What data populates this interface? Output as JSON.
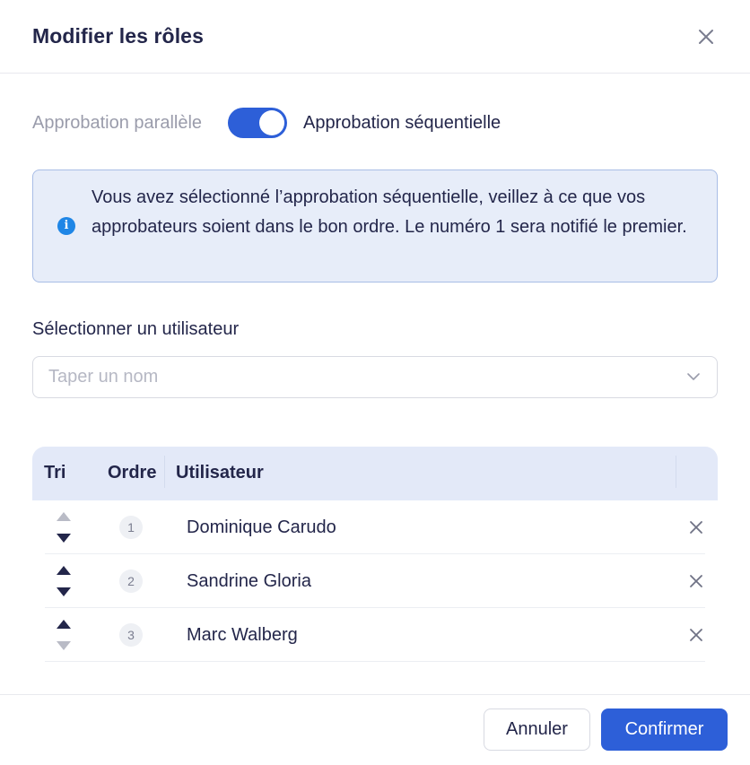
{
  "modal": {
    "title": "Modifier les rôles",
    "close_icon": "close-icon"
  },
  "approval": {
    "left_label": "Approbation parallèle",
    "right_label": "Approbation séquentielle",
    "toggle_on": true,
    "accent": "#2d5fd8"
  },
  "info": {
    "icon": "info-icon",
    "icon_glyph": "i",
    "text": "Vous avez sélectionné l’approbation séquentielle, veillez à ce que vos approbateurs soient dans le bon ordre. Le numéro 1 sera notifié le premier."
  },
  "user_select": {
    "label": "Sélectionner un utilisateur",
    "placeholder": "Taper un nom",
    "value": ""
  },
  "table": {
    "headers": {
      "sort": "Tri",
      "order": "Ordre",
      "user": "Utilisateur"
    },
    "rows": [
      {
        "order": "1",
        "name": "Dominique Carudo",
        "up_enabled": false,
        "down_enabled": true
      },
      {
        "order": "2",
        "name": "Sandrine Gloria",
        "up_enabled": true,
        "down_enabled": true
      },
      {
        "order": "3",
        "name": "Marc Walberg",
        "up_enabled": true,
        "down_enabled": false
      }
    ]
  },
  "footer": {
    "cancel_label": "Annuler",
    "confirm_label": "Confirmer"
  },
  "colors": {
    "primary": "#2d5fd8",
    "info_bg": "#e7edf9",
    "info_border": "#a8bde6",
    "header_bg": "#e3e9f8",
    "arrow_active": "#23264a",
    "arrow_disabled": "#b9bbc6"
  }
}
